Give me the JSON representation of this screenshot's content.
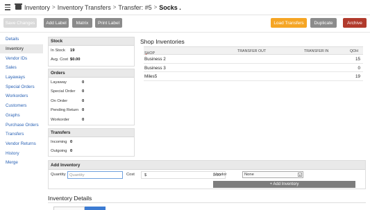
{
  "breadcrumb": {
    "items": [
      "Inventory",
      "Inventory Transfers",
      "Transfer: #5"
    ],
    "current": "Socks ."
  },
  "toolbar": {
    "save_changes": "Save Changes",
    "add_label": "Add Label",
    "matrix": "Matrix",
    "print_label": "Print Label",
    "load_transfers": "Load Transfers",
    "duplicate": "Duplicate",
    "archive": "Archive"
  },
  "colors": {
    "link": "#2a62b5",
    "load_transfers": "#f5a524",
    "archive": "#b13a2c",
    "gray_button": "#8b8b8b",
    "active_tab": "#3c7bd2"
  },
  "sidebar": {
    "items": [
      {
        "label": "Details"
      },
      {
        "label": "Inventory",
        "active": true
      },
      {
        "label": "Vendor IDs"
      },
      {
        "label": "Sales"
      },
      {
        "label": "Layaways"
      },
      {
        "label": "Special Orders"
      },
      {
        "label": "Workorders"
      },
      {
        "label": "Customers"
      },
      {
        "label": "Graphs"
      },
      {
        "label": "Purchase Orders"
      },
      {
        "label": "Transfers"
      },
      {
        "label": "Vendor Returns"
      },
      {
        "label": "History"
      },
      {
        "label": "Merge"
      }
    ]
  },
  "stock": {
    "title": "Stock",
    "in_stock_label": "In Stock",
    "in_stock_value": "19",
    "avg_cost_label": "Avg. Cost",
    "avg_cost_value": "$0.00"
  },
  "orders": {
    "title": "Orders",
    "rows": [
      {
        "label": "Layaway",
        "value": "0"
      },
      {
        "label": "Special Order",
        "value": "0"
      },
      {
        "label": "On Order",
        "value": "0"
      },
      {
        "label": "Pending Return",
        "value": "0"
      },
      {
        "label": "Workorder",
        "value": "0"
      }
    ]
  },
  "transfers": {
    "title": "Transfers",
    "rows": [
      {
        "label": "Incoming",
        "value": "0"
      },
      {
        "label": "Outgoing",
        "value": "0"
      }
    ]
  },
  "shop_inventories": {
    "title": "Shop Inventories",
    "columns": [
      "Shop",
      "Transfer Out",
      "Transfer In",
      "QOH"
    ],
    "rows": [
      {
        "shop": "Business 2",
        "qoh": "15"
      },
      {
        "shop": "Business 3",
        "qoh": "0"
      },
      {
        "shop": "Miles5",
        "qoh": "19"
      }
    ]
  },
  "add_inventory": {
    "title": "Add Inventory",
    "quantity_label": "Quantity",
    "quantity_placeholder": "Quantity",
    "cost_label": "Cost",
    "cost_currency": "$",
    "cost_value": "0.00",
    "vendor_label": "Vendor",
    "vendor_value": "None",
    "add_button": "+ Add Inventory"
  },
  "inventory_details": {
    "title": "Inventory Details"
  }
}
